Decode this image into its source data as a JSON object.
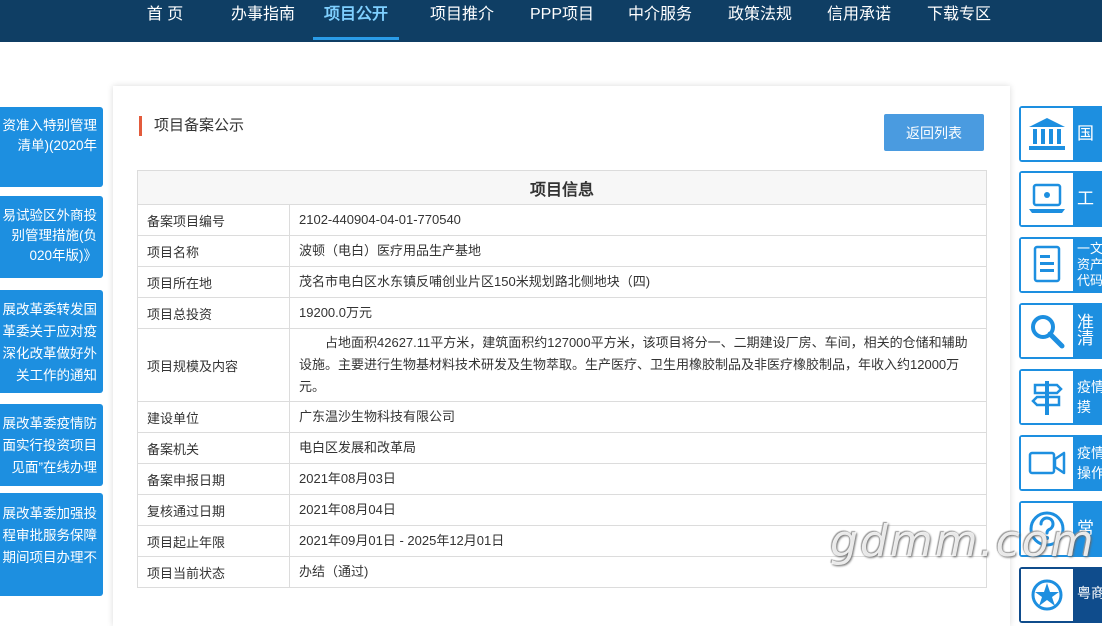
{
  "nav": {
    "items": [
      "首 页",
      "办事指南",
      "项目公开",
      "项目推介",
      "PPP项目",
      "中介服务",
      "政策法规",
      "信用承诺",
      "下载专区"
    ],
    "active": "项目公开"
  },
  "left_news": [
    {
      "lines": [
        "资准入特别管理",
        "清单)(2020年"
      ]
    },
    {
      "lines": [
        "易试验区外商投",
        "别管理措施(负",
        "020年版)》"
      ]
    },
    {
      "lines": [
        "展改革委转发国",
        "革委关于应对疫",
        "深化改革做好外",
        "关工作的通知"
      ]
    },
    {
      "lines": [
        "展改革委疫情防",
        "面实行投资项目",
        "见面”在线办理"
      ]
    },
    {
      "lines": [
        "展改革委加强投",
        "程审批服务保障",
        "期间项目办理不"
      ]
    }
  ],
  "main": {
    "section_title": "项目备案公示",
    "back_button": "返回列表",
    "table_title": "项目信息",
    "rows": [
      {
        "label": "备案项目编号",
        "value": "2102-440904-04-01-770540"
      },
      {
        "label": "项目名称",
        "value": "波顿（电白）医疗用品生产基地"
      },
      {
        "label": "项目所在地",
        "value": "茂名市电白区水东镇反哺创业片区150米规划路北侧地块（四)"
      },
      {
        "label": "项目总投资",
        "value": "19200.0万元"
      },
      {
        "label": "项目规模及内容",
        "value": "占地面积42627.11平方米，建筑面积约127000平方米，该项目将分一、二期建设厂房、车间，相关的仓储和辅助设施。主要进行生物基材料技术研发及生物萃取。生产医疗、卫生用橡胶制品及非医疗橡胶制品，年收入约12000万元。"
      },
      {
        "label": "建设单位",
        "value": "广东温沙生物科技有限公司"
      },
      {
        "label": "备案机关",
        "value": "电白区发展和改革局"
      },
      {
        "label": "备案申报日期",
        "value": "2021年08月03日"
      },
      {
        "label": "复核通过日期",
        "value": "2021年08月04日"
      },
      {
        "label": "项目起止年限",
        "value": "2021年09月01日 - 2025年12月01日"
      },
      {
        "label": "项目当前状态",
        "value": "办结（通过)"
      }
    ]
  },
  "right_tiles": [
    {
      "icon": "government-building-icon",
      "lines": [
        "国"
      ]
    },
    {
      "icon": "laptop-icon",
      "lines": [
        "工"
      ]
    },
    {
      "icon": "certificate-icon",
      "lines": [
        "一文",
        "资产",
        "代码"
      ]
    },
    {
      "icon": "search-icon",
      "lines": [
        "准",
        "清"
      ]
    },
    {
      "icon": "signpost-icon",
      "lines": [
        "疫情",
        "摸"
      ]
    },
    {
      "icon": "video-icon",
      "lines": [
        "疫情",
        "操作"
      ]
    },
    {
      "icon": "question-icon",
      "lines": [
        "常"
      ]
    },
    {
      "icon": "emblem-icon",
      "lines": [
        "粤商"
      ]
    }
  ],
  "watermark": "gdmm.com",
  "colors": {
    "nav_bg": "#0f3e64",
    "accent_blue": "#1d8fe0",
    "button": "#4a9be0",
    "title_bar": "#e35b3c"
  }
}
